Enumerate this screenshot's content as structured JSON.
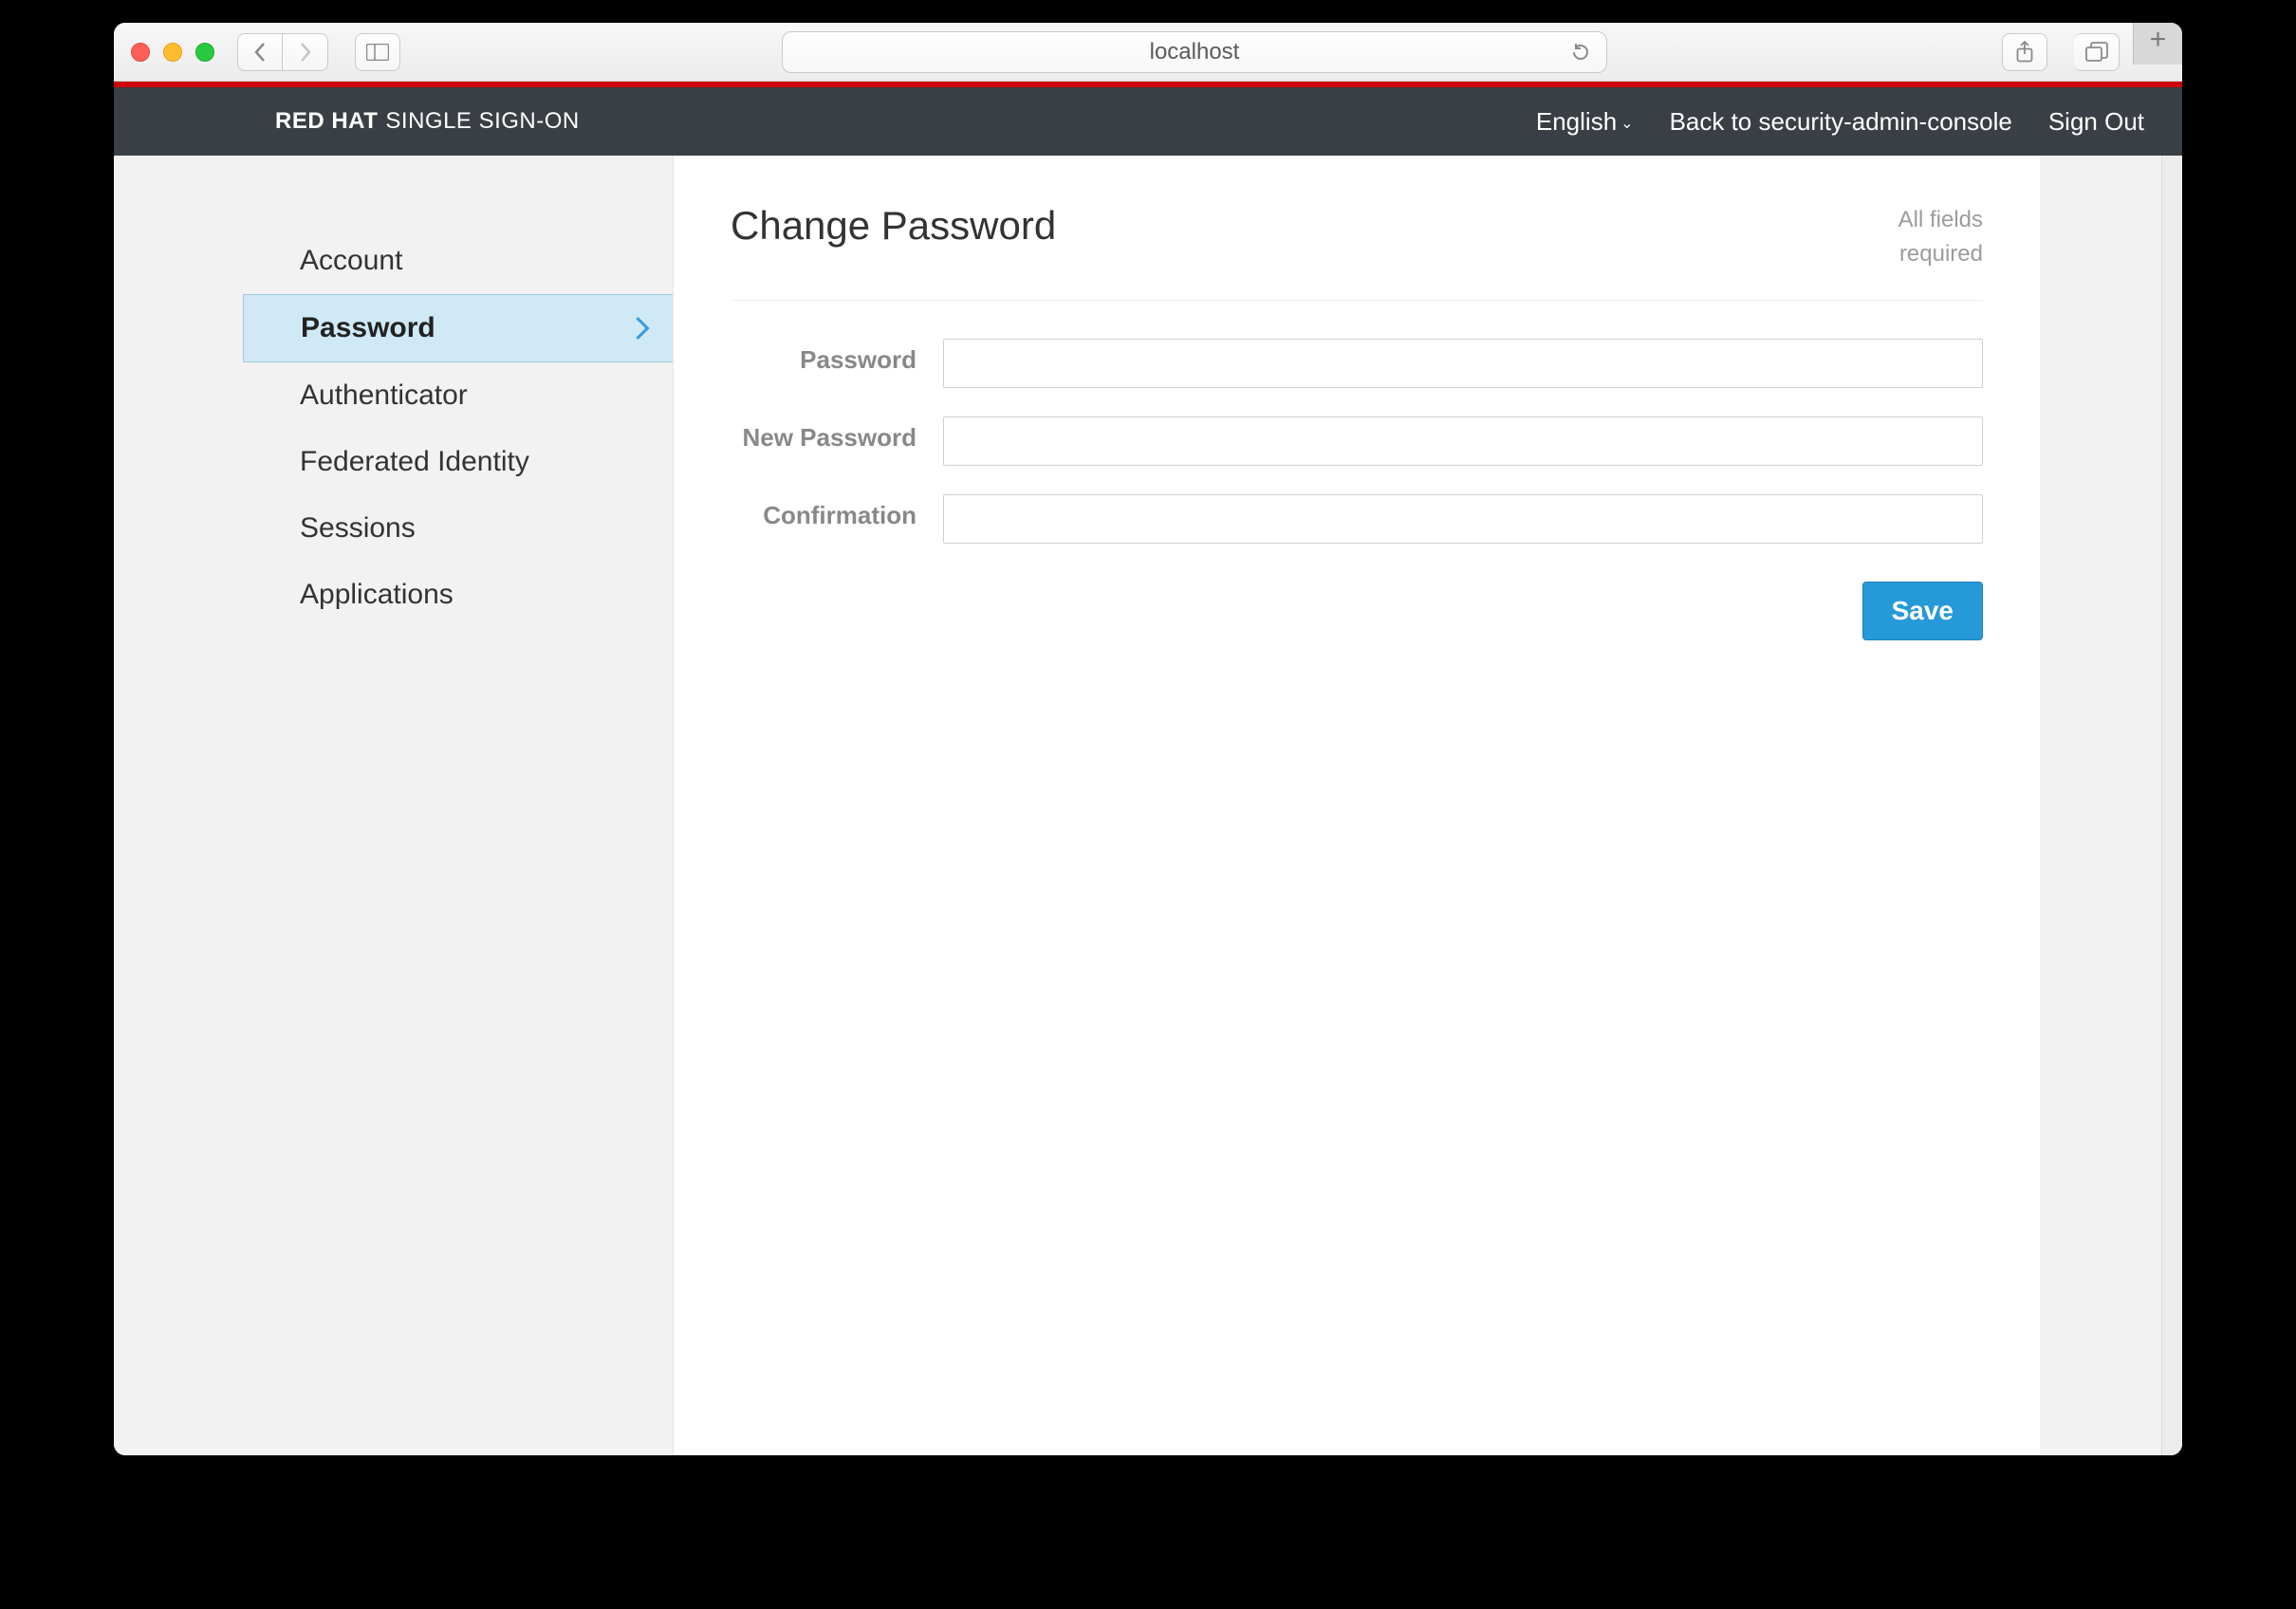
{
  "browser": {
    "url": "localhost"
  },
  "header": {
    "brand_strong": "RED HAT",
    "brand_light": "SINGLE SIGN-ON",
    "language": "English",
    "back_link": "Back to security-admin-console",
    "sign_out": "Sign Out"
  },
  "sidebar": {
    "items": [
      {
        "label": "Account",
        "active": false
      },
      {
        "label": "Password",
        "active": true
      },
      {
        "label": "Authenticator",
        "active": false
      },
      {
        "label": "Federated Identity",
        "active": false
      },
      {
        "label": "Sessions",
        "active": false
      },
      {
        "label": "Applications",
        "active": false
      }
    ]
  },
  "page": {
    "title": "Change Password",
    "required_note_line1": "All fields",
    "required_note_line2": "required",
    "fields": {
      "password_label": "Password",
      "new_password_label": "New Password",
      "confirmation_label": "Confirmation"
    },
    "save_label": "Save"
  }
}
